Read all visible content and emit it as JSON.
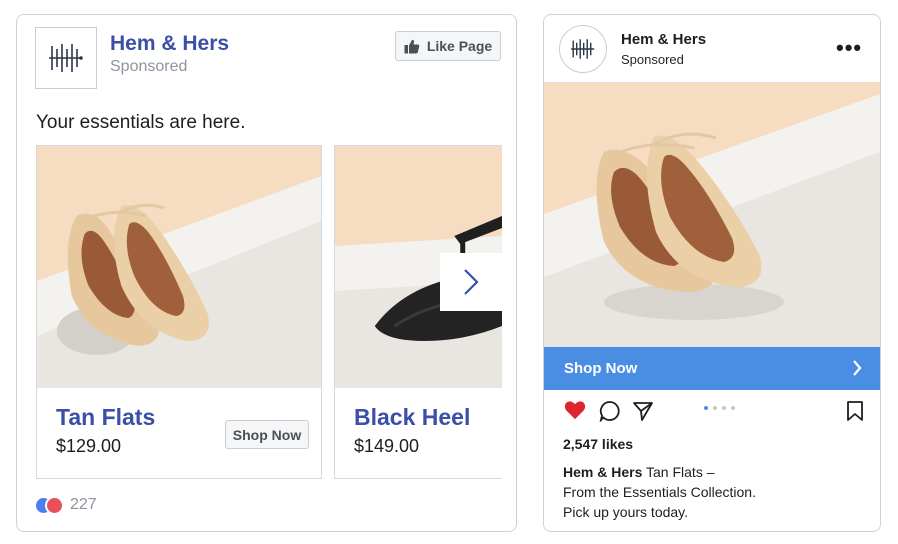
{
  "facebook": {
    "brand_name": "Hem & Hers",
    "sponsored": "Sponsored",
    "like_page_label": "Like Page",
    "post_text": "Your essentials are here.",
    "carousel": [
      {
        "title": "Tan Flats",
        "price": "$129.00",
        "cta": "Shop Now"
      },
      {
        "title": "Black Heel",
        "price": "$149.00"
      }
    ],
    "reaction_count": "227"
  },
  "instagram": {
    "brand_name": "Hem & Hers",
    "sponsored": "Sponsored",
    "cta": "Shop Now",
    "likes": "2,547 likes",
    "caption_user": "Hem & Hers",
    "caption_line1": "Tan Flats –",
    "caption_line2": "From the Essentials Collection.",
    "caption_line3": "Pick up yours today."
  },
  "colors": {
    "brand_blue": "#3b4fa8",
    "ig_cta_blue": "#4a8ee4",
    "heart_red": "#e0242f",
    "backdrop_peach": "#f6dcc0"
  },
  "icons": [
    "hem-and-hers-logo-icon",
    "thumbs-up-icon",
    "chevron-right-icon",
    "more-dots-icon",
    "heart-icon",
    "comment-icon",
    "send-icon",
    "bookmark-icon"
  ]
}
